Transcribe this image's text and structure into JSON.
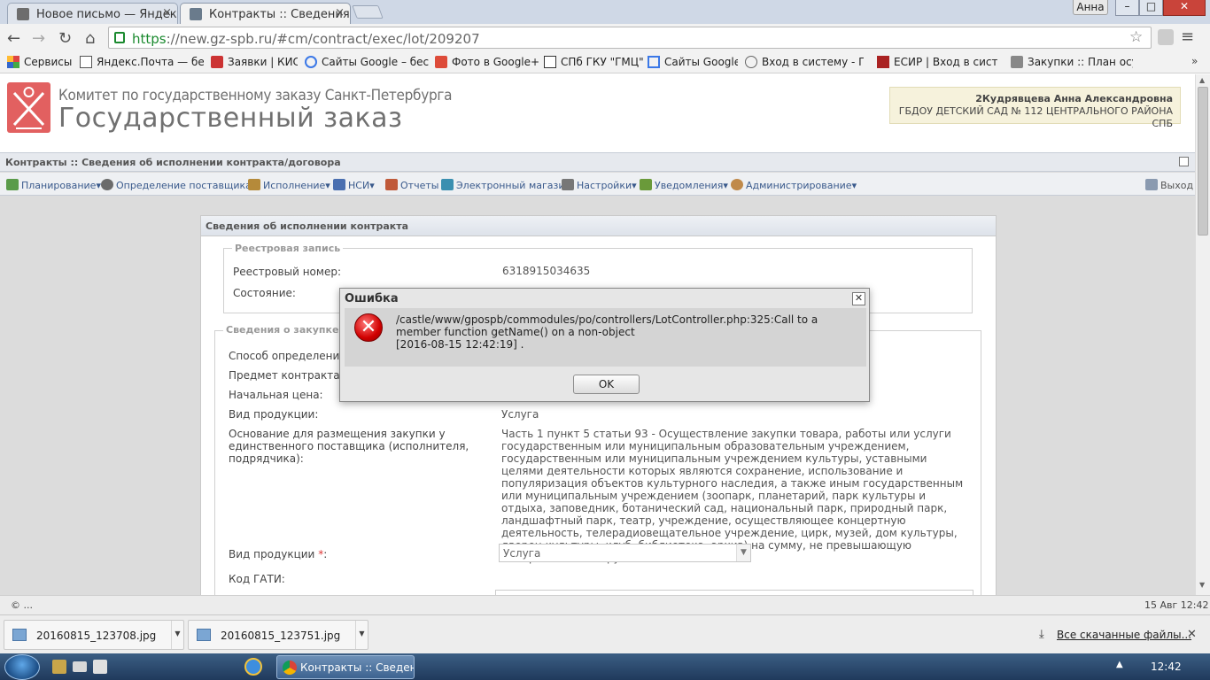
{
  "browser": {
    "tabs": [
      {
        "title": "Новое письмо — Яндекс",
        "close": "×"
      },
      {
        "title": "Контракты :: Сведения об",
        "close": "×"
      }
    ],
    "user_badge": "Анна",
    "window_controls": {
      "minimize": "–",
      "maximize": "□",
      "close": "✕"
    },
    "url_scheme": "https",
    "url_rest": "://new.gz-spb.ru/#cm/contract/exec/lot/209207",
    "bookmarks": [
      {
        "label": "Сервисы",
        "icon_color": "#d44"
      },
      {
        "label": "Яндекс.Почта — бес",
        "icon_color": "#555"
      },
      {
        "label": "Заявки | КИС",
        "icon_color": "#c33"
      },
      {
        "label": "Сайты Google – бесп",
        "icon_color": "#3b78e7"
      },
      {
        "label": "Фото в Google+",
        "icon_color": "#dd4b39"
      },
      {
        "label": "СПб ГКУ \"ГМЦ\"",
        "icon_color": "#333"
      },
      {
        "label": "Сайты Google",
        "icon_color": "#3b78e7"
      },
      {
        "label": "Вход в систему - ПК",
        "icon_color": "#666"
      },
      {
        "label": "ЕСИР | Вход в систем",
        "icon_color": "#a22"
      },
      {
        "label": "Закупки :: План осущ",
        "icon_color": "#777"
      }
    ]
  },
  "header": {
    "org_line": "Комитет по государственному заказу Санкт-Петербурга",
    "app_title": "Государственный заказ",
    "user_name": "2Кудрявцева Анна Александровна",
    "user_org": "ГБДОУ ДЕТСКИЙ САД № 112 ЦЕНТРАЛЬНОГО РАЙОНА СПБ"
  },
  "breadcrumb": "Контракты :: Сведения об исполнении контракта/договора",
  "menu": {
    "items": [
      {
        "label": "Планирование",
        "arrow": "▾",
        "icon_color": "#5a9b4a"
      },
      {
        "label": "Определение поставщика",
        "arrow": "▾",
        "icon_color": "#6b6b6b"
      },
      {
        "label": "Исполнение",
        "arrow": "▾",
        "icon_color": "#b58a3a"
      },
      {
        "label": "НСИ",
        "arrow": "▾",
        "icon_color": "#4a6fb0"
      },
      {
        "label": "Отчеты",
        "arrow": "",
        "icon_color": "#c05a3a"
      },
      {
        "label": "Электронный магазин",
        "arrow": "",
        "icon_color": "#3a8fb0"
      },
      {
        "label": "Настройки",
        "arrow": "▾",
        "icon_color": "#777"
      },
      {
        "label": "Уведомления",
        "arrow": "▾",
        "icon_color": "#6a9a3a"
      },
      {
        "label": "Администрирование",
        "arrow": "▾",
        "icon_color": "#c08a4a"
      }
    ],
    "logout": "Выход"
  },
  "panel": {
    "title": "Сведения об исполнении контракта",
    "registry": {
      "legend": "Реестровая запись",
      "number_label": "Реестровый номер:",
      "number_value": "6318915034635",
      "state_label": "Состояние:"
    },
    "purchase": {
      "legend": "Сведения о закупке",
      "method_label": "Способ определения п",
      "subject_label": "Предмет контракта (л",
      "price_label": "Начальная цена:",
      "product_label": "Вид продукции:",
      "product_value": "Услуга",
      "basis_label": "Основание для размещения закупки у единственного поставщика (исполнителя, подрядчика):",
      "basis_value": "Часть 1 пункт 5 статьи 93 - Осуществление закупки товара, работы или услуги государственным или муниципальным образовательным учреждением, государственным или муниципальным учреждением культуры, уставными целями деятельности которых являются сохранение, использование и популяризация объектов культурного наследия, а также иным государственным или муниципальным учреждением (зоопарк, планетарий, парк культуры и отдыха, заповедник, ботанический сад, национальный парк, природный парк, ландшафтный парк, театр, учреждение, осуществляющее концертную деятельность, телерадиовещательное учреждение, цирк, музей, дом культуры, дворец культуры, клуб, библиотека, архив) на сумму, не превышающую четырехсот тысяч рублей.",
      "product_select_label": "Вид продукции",
      "required_mark": "*",
      "colon": ":",
      "product_select_value": "Услуга",
      "gati_label": "Код ГАТИ:"
    }
  },
  "status": {
    "left": "© ...",
    "right": "15 Авг 12:42"
  },
  "downloads": {
    "files": [
      "20160815_123708.jpg",
      "20160815_123751.jpg"
    ],
    "all_link": "Все скачанные файлы...",
    "close": "✕"
  },
  "taskbar": {
    "task": "Контракты :: Сведен...",
    "clock": "12:42"
  },
  "dialog": {
    "title": "Ошибка",
    "close": "✕",
    "icon": "✕",
    "message_line1": "/castle/www/gpospb/commodules/po/controllers/LotController.php:325:Call to a member function getName() on a non-object",
    "message_line2": "[2016-08-15 12:42:19] .",
    "ok_label": "OK"
  },
  "colors": {
    "accent_blue": "#3a5a8c",
    "secure_green": "#1b8a2f",
    "error_red": "#d10000"
  }
}
